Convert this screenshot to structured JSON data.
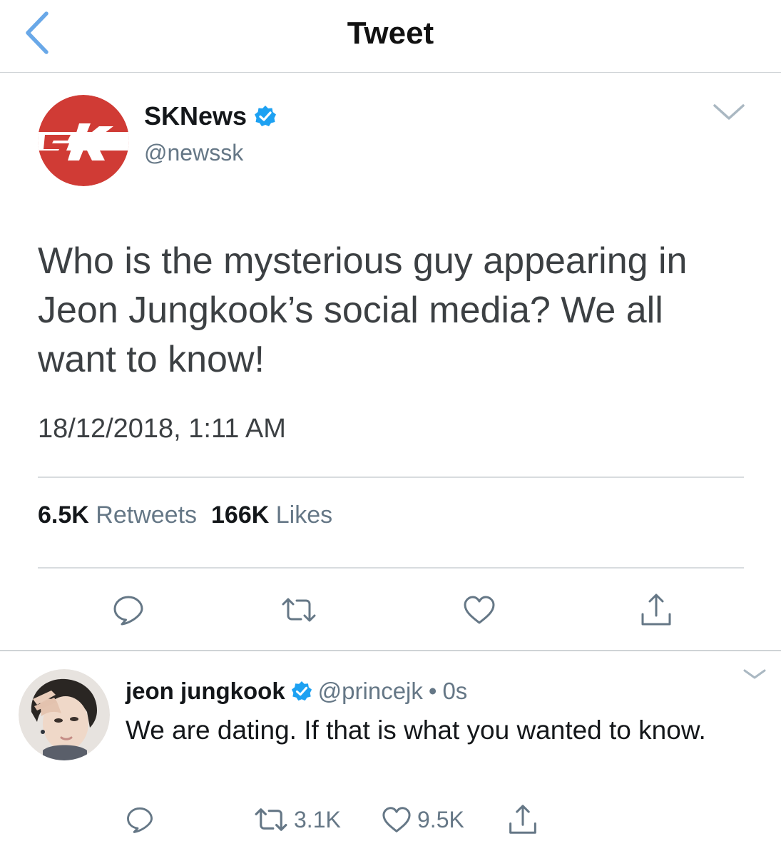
{
  "header": {
    "title": "Tweet"
  },
  "main_tweet": {
    "author_name": "SKNews",
    "handle": "@newssk",
    "text": "Who is the mysterious guy appearing in Jeon Jungkook’s social media? We all want to know!",
    "timestamp": "18/12/2018, 1:11 AM",
    "retweet_count": "6.5K",
    "retweet_label": "Retweets",
    "like_count": "166K",
    "like_label": "Likes"
  },
  "reply": {
    "author_name": "jeon jungkook",
    "handle": "@princejk",
    "separator": "•",
    "time": "0s",
    "text": "We are dating. If that is what you wanted to know.",
    "retweet_count": "3.1K",
    "like_count": "9.5K"
  },
  "colors": {
    "accent_blue": "#1da1f2",
    "back_chevron": "#69a8e8",
    "secondary_text": "#657786",
    "sk_red": "#d03b35"
  },
  "icons": {
    "back": "chevron-left-icon",
    "verified": "verified-badge-icon",
    "caret": "chevron-down-icon",
    "reply": "reply-icon",
    "retweet": "retweet-icon",
    "like": "heart-icon",
    "share": "share-icon"
  }
}
